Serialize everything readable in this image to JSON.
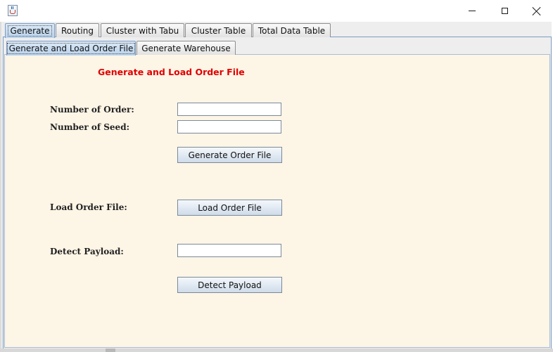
{
  "window": {
    "title": "",
    "icon": "java-cup-icon",
    "controls": [
      "minimize",
      "maximize",
      "close"
    ]
  },
  "main_tabs": [
    {
      "label": "Generate",
      "selected": true
    },
    {
      "label": "Routing",
      "selected": false
    },
    {
      "label": "Cluster with Tabu",
      "selected": false
    },
    {
      "label": "Cluster Table",
      "selected": false
    },
    {
      "label": "Total Data Table",
      "selected": false
    }
  ],
  "sub_tabs": [
    {
      "label": "Generate and Load Order File",
      "selected": true
    },
    {
      "label": "Generate Warehouse",
      "selected": false
    }
  ],
  "panel": {
    "heading": "Generate and Load Order File",
    "number_of_order_label": "Number of Order:",
    "number_of_order_value": "",
    "number_of_seed_label": "Number of Seed:",
    "number_of_seed_value": "",
    "generate_button": "Generate Order File",
    "load_label": "Load Order File:",
    "load_button": "Load Order File",
    "detect_label": "Detect Payload:",
    "detect_value": "",
    "detect_button": "Detect Payload"
  },
  "colors": {
    "heading": "#e00000",
    "panel_background": "#fdf5e6",
    "selected_tab": "#b8d2ec"
  }
}
